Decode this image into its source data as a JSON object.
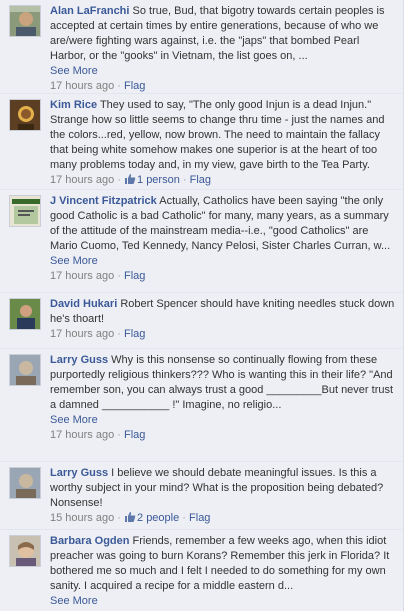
{
  "comments": [
    {
      "author": "Alan LaFranchi",
      "text": "So true, Bud, that bigotry towards certain peoples is accepted at certain times by entire generations, because of who we are/were fighting wars against, i.e. the \"japs\" that bombed Pearl Harbor, or the \"gooks\" in Vietnam, the list goes on, ...",
      "see_more": "See More",
      "time": "17 hours ago",
      "likes": "",
      "flag": "Flag"
    },
    {
      "author": "Kim Rice",
      "text": "They used to say, \"The only good Injun is a dead Injun.\" Strange how so little seems to change thru time - just the names and the colors...red, yellow, now brown. The need to maintain the fallacy that being white somehow makes one superior is at the heart of too many problems today and, in my view, gave birth to the Tea Party.",
      "see_more": "",
      "time": "17 hours ago",
      "likes": "1 person",
      "flag": "Flag"
    },
    {
      "author": "J Vincent Fitzpatrick",
      "text": "Actually, Catholics have been saying \"the only good Catholic is a bad Catholic\" for many, many years, as a summary of the attitude of the mainstream media--i.e., \"good Catholics\" are Mario Cuomo, Ted Kennedy, Nancy Pelosi, Sister Charles Curran, w...",
      "see_more": "See More",
      "time": "17 hours ago",
      "likes": "",
      "flag": "Flag"
    },
    {
      "author": "David Hukari",
      "text": "Robert Spencer should have kniting needles stuck down he's thoart!",
      "see_more": "",
      "time": "17 hours ago",
      "likes": "",
      "flag": "Flag"
    },
    {
      "author": "Larry Guss",
      "text": "Why is this nonsense so continually flowing from these purportedly religious thinkers??? Who is wanting this in their life? \"And remember son, you can always trust a good _________But never trust a damned ___________ !\" Imagine, no religio...",
      "see_more": "See More",
      "time": "17 hours ago",
      "likes": "",
      "flag": "Flag"
    },
    {
      "author": "Larry Guss",
      "text": "I believe we should debate meaningful issues. Is this a worthy subject in your mind? What is the proposition being debated? Nonsense!",
      "see_more": "",
      "time": "15 hours ago",
      "likes": "2 people",
      "flag": "Flag"
    },
    {
      "author": "Barbara Ogden",
      "text": "Friends, remember a few weeks ago, when this idiot preacher was going to burn Korans? Remember this jerk in Florida? It bothered me so much and I felt I needed to do something for my own sanity. I acquired a recipe for a middle eastern d...",
      "see_more": "See More",
      "time": "",
      "likes": "",
      "flag": ""
    }
  ],
  "icons": {
    "like": "thumbs-up-icon"
  },
  "colors": {
    "link": "#3b5998",
    "background": "#edeff4",
    "meta": "#808080"
  }
}
